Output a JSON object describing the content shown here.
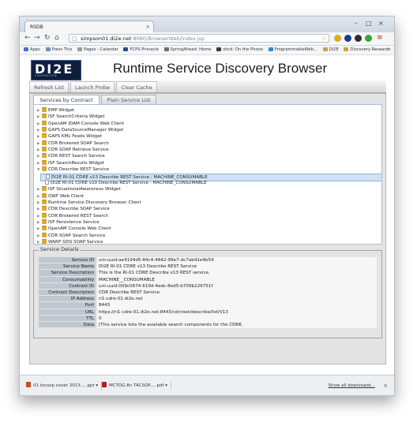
{
  "browser": {
    "tab_title": "RSDB",
    "url_host": "simpson01.di2e.net",
    "url_rest": ":8080/BrowserWeb/index.jsp",
    "bookmarks": [
      "Apps",
      "Press This",
      "Pages - Calendar",
      "FCPS Pinnacle",
      "SpringAhead: Home",
      "xkcd: On the Phone",
      "ProgrammableWeb...",
      "DI2E",
      "Discovery Research"
    ],
    "more_bookmarks": "»"
  },
  "app": {
    "logo_text": "DI2E",
    "logo_subtext": "FEDERATION",
    "title": "Runtime Service Discovery Browser",
    "buttons": [
      "Refresh List",
      "Launch Probe",
      "Clear Cache"
    ],
    "tabs": [
      "Services by Contract",
      "Plain Service List"
    ]
  },
  "tree": [
    {
      "label": "EMP Widget",
      "type": "folder",
      "level": 0
    },
    {
      "label": "ISF SearchCriteria Widget",
      "type": "folder",
      "level": 0
    },
    {
      "label": "OpenAM IDAM Console Web Client",
      "type": "folder",
      "level": 0
    },
    {
      "label": "GAPS DataSourceManager Widget",
      "type": "folder",
      "level": 0
    },
    {
      "label": "GAPS KML Feeds Widget",
      "type": "folder",
      "level": 0
    },
    {
      "label": "CDR Brokered SOAP Search",
      "type": "folder",
      "level": 0
    },
    {
      "label": "CDR SOAP Retrieve Service",
      "type": "folder",
      "level": 0
    },
    {
      "label": "CDR REST Search Service",
      "type": "folder",
      "level": 0
    },
    {
      "label": "ISF SearchResults Widget",
      "type": "folder",
      "level": 0
    },
    {
      "label": "CDR Describe REST Service",
      "type": "folder",
      "level": 0,
      "open": true
    },
    {
      "label": "DI2E RI-01 CDRE v13 Describe REST Service : MACHINE_CONSUMABLE",
      "type": "file",
      "level": 1,
      "selected": true
    },
    {
      "label": "DI2E RI-01 CDRE v10 Describe REST Service : MACHINE_CONSUMABLE",
      "type": "file",
      "level": 1
    },
    {
      "label": "ISF SituationalAwareness Widget",
      "type": "folder",
      "level": 0
    },
    {
      "label": "OWF Web Client",
      "type": "folder",
      "level": 0
    },
    {
      "label": "Runtime Service Discovery Browser Client",
      "type": "folder",
      "level": 0
    },
    {
      "label": "CDR Describe SOAP Service",
      "type": "folder",
      "level": 0
    },
    {
      "label": "CDR Brokered REST Search",
      "type": "folder",
      "level": 0
    },
    {
      "label": "ISF Persistence Service",
      "type": "folder",
      "level": 0
    },
    {
      "label": "OpenAM Console Web Client",
      "type": "folder",
      "level": 0
    },
    {
      "label": "CDR SOAP Search Service",
      "type": "folder",
      "level": 0
    },
    {
      "label": "WARP GDS SOAP Service",
      "type": "folder",
      "level": 0
    }
  ],
  "details": {
    "legend": "Service Details",
    "rows": [
      {
        "key": "Service ID",
        "value": "urn:uuid:ae4194d5-84c4-4842-99e7-dc7ab41e4b54"
      },
      {
        "key": "Service Name",
        "value": "DI2E RI-01 CDRE v13 Describe REST Service"
      },
      {
        "key": "Service Description",
        "value": "This is the RI-01 CDRE Describe v13 REST service."
      },
      {
        "key": "Consumability",
        "value": "MACHINE__CONSUMABLE"
      },
      {
        "key": "Contract ID",
        "value": "urn:uuid:009c0674-619d-4edc-8ed5-b709b229751f"
      },
      {
        "key": "Contract Description",
        "value": "CDR Describe REST Service"
      },
      {
        "key": "IP Address",
        "value": "ri1-cdre-01.di2e.net"
      },
      {
        "key": "Port",
        "value": "8443"
      },
      {
        "key": "URL",
        "value": "https://ri1-cdre-01.di2e.net:8443/cdr/rest/describe/list/V13"
      },
      {
        "key": "TTL",
        "value": "0"
      },
      {
        "key": "Data",
        "value": "[This service lists the available search components for the CDRE."
      }
    ]
  },
  "downloads": {
    "items": [
      "01 tocsop cover 2013.....ppt",
      "MCTOG 8n TACSOP.....pdf"
    ],
    "show_all": "Show all downloads...",
    "close": "×"
  },
  "colors": {
    "accent": "#0d1f3c",
    "selection": "#cfe3f5",
    "folder": "#d9a934"
  }
}
